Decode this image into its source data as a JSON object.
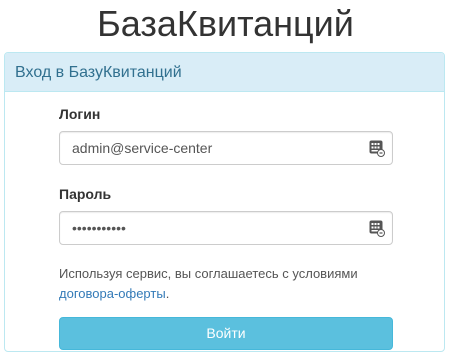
{
  "app": {
    "title": "БазаКвитанций"
  },
  "panel": {
    "heading": "Вход в БазуКвитанций"
  },
  "login_form": {
    "login_label": "Логин",
    "login_value": "admin@service-center",
    "password_label": "Пароль",
    "password_value": "•••••••••••",
    "field_icon": "password-manager-icon",
    "terms_text": "Используя сервис, вы соглашаетесь с условиями",
    "terms_link": "договора-оферты",
    "terms_end": ".",
    "submit_label": "Войти"
  },
  "colors": {
    "panel_heading_bg": "#d9edf7",
    "panel_heading_text": "#31708f",
    "panel_border": "#bce8f1",
    "link": "#337ab7",
    "button_bg": "#5bc0de",
    "button_text": "#ffffff"
  }
}
